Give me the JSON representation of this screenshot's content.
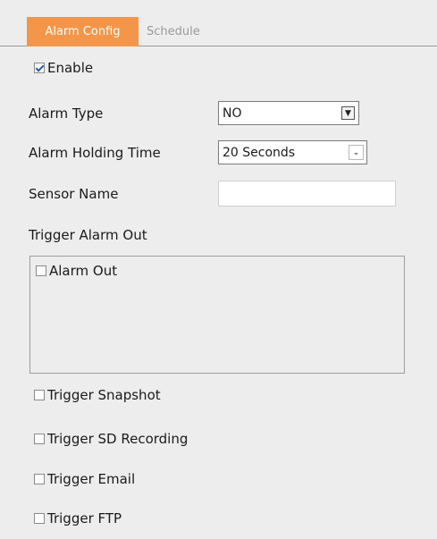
{
  "tabs": {
    "alarm_config": "Alarm Config",
    "schedule": "Schedule"
  },
  "enable": {
    "label": "Enable",
    "checked": true
  },
  "alarm_type": {
    "label": "Alarm Type",
    "value": "NO"
  },
  "alarm_holding_time": {
    "label": "Alarm Holding Time",
    "value": "20 Seconds"
  },
  "sensor_name": {
    "label": "Sensor Name",
    "value": ""
  },
  "trigger_alarm_out": {
    "label": "Trigger Alarm Out",
    "alarm_out_label": "Alarm Out",
    "alarm_out_checked": false
  },
  "triggers": {
    "snapshot": "Trigger Snapshot",
    "sd_recording": "Trigger SD Recording",
    "email": "Trigger Email",
    "ftp": "Trigger FTP"
  },
  "colors": {
    "accent": "#f4964a",
    "background": "#ededed"
  }
}
